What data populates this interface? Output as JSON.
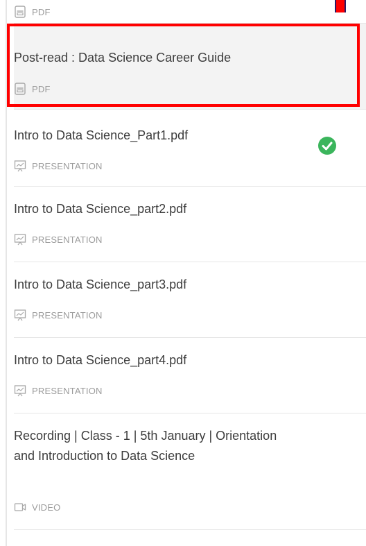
{
  "items": [
    {
      "title": "",
      "type": "PDF",
      "icon": "pdf-icon"
    },
    {
      "title": "Post-read : Data Science Career Guide",
      "type": "PDF",
      "icon": "pdf-icon"
    },
    {
      "title": "Intro to Data Science_Part1.pdf",
      "type": "PRESENTATION",
      "icon": "presentation-icon"
    },
    {
      "title": "Intro to Data Science_part2.pdf",
      "type": "PRESENTATION",
      "icon": "presentation-icon"
    },
    {
      "title": "Intro to Data Science_part3.pdf",
      "type": "PRESENTATION",
      "icon": "presentation-icon"
    },
    {
      "title": "Intro to Data Science_part4.pdf",
      "type": "PRESENTATION",
      "icon": "presentation-icon"
    },
    {
      "title": "Recording | Class - 1 | 5th January | Orientation and Introduction to Data Science",
      "type": "VIDEO",
      "icon": "video-icon"
    }
  ],
  "colors": {
    "highlight": "#ff0000",
    "check": "#3bb55c"
  }
}
